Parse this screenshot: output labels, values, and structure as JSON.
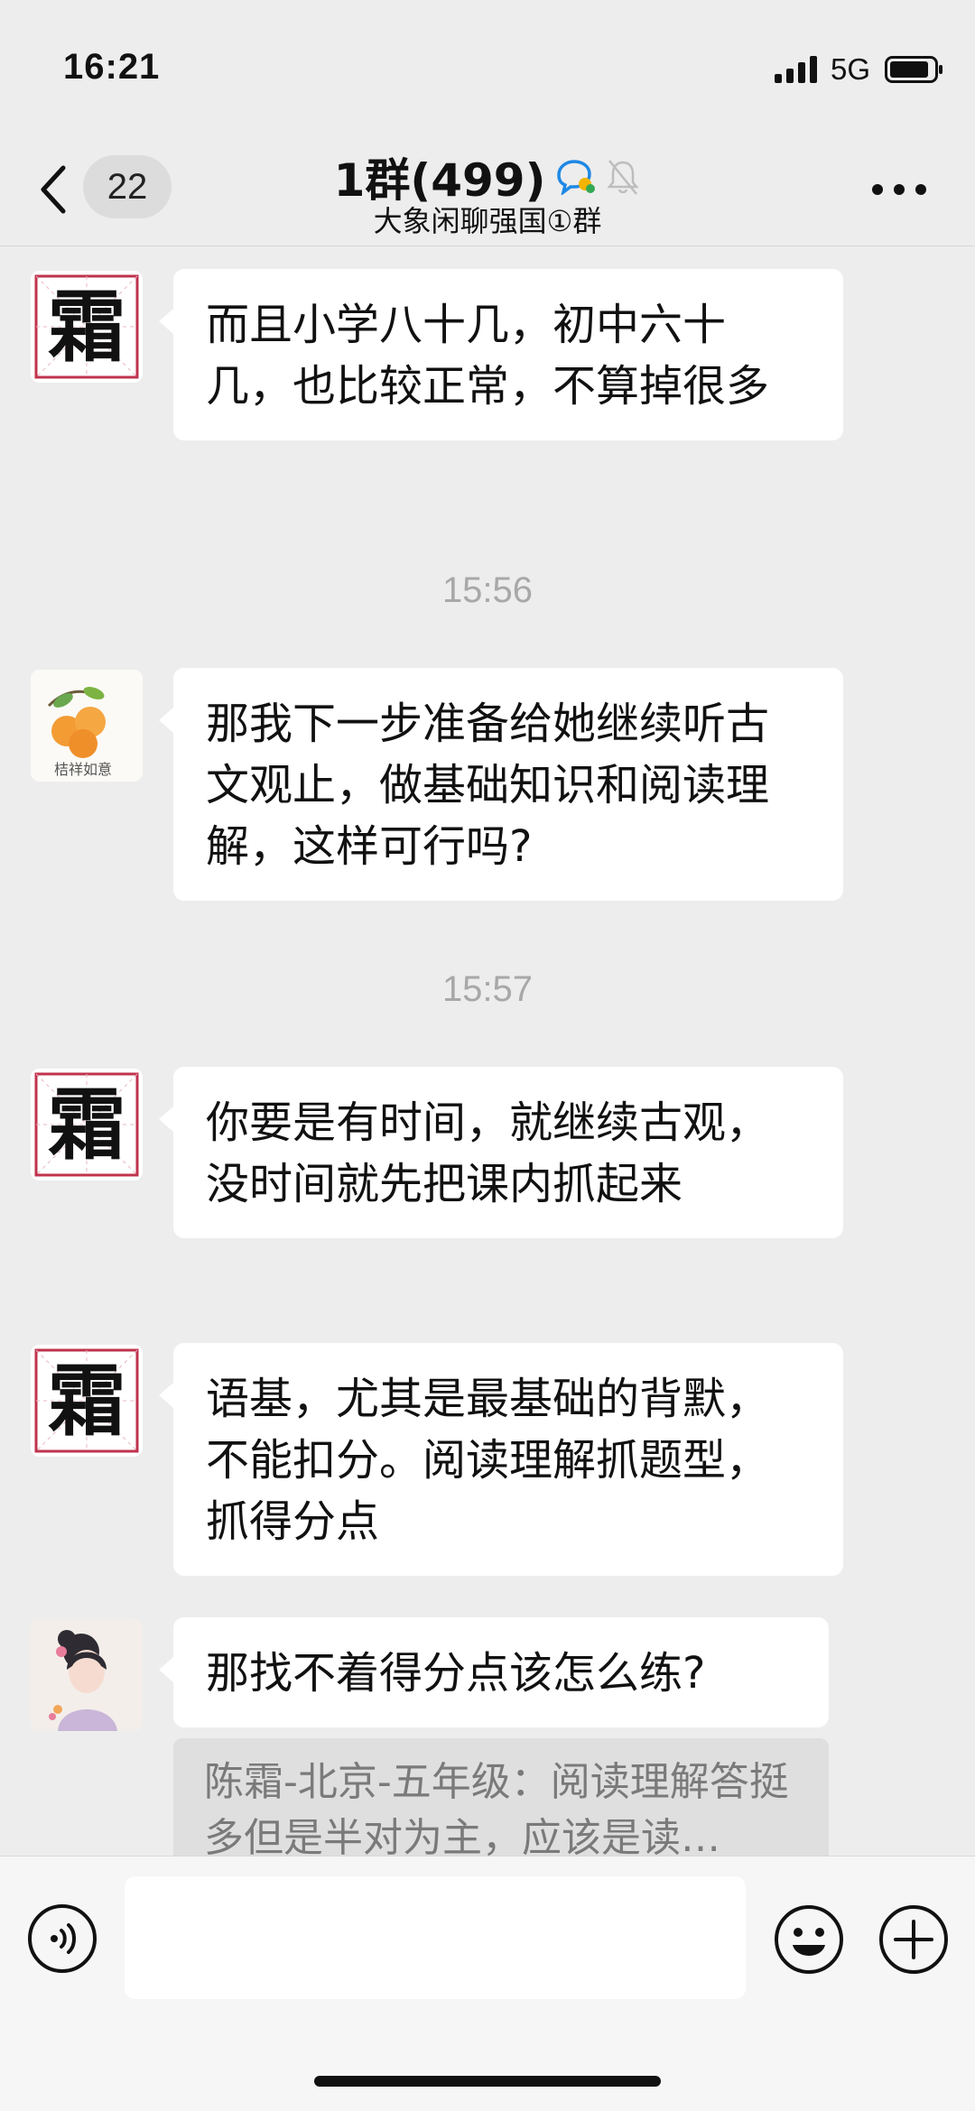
{
  "status": {
    "time": "16:21",
    "network": "5G"
  },
  "nav": {
    "unread_count": "22",
    "title": "1群(499)",
    "subtitle": "大象闲聊强国①群"
  },
  "messages": [
    {
      "sender_avatar": "霜",
      "text": "而且小学八十几，初中六十几，也比较正常，不算掉很多"
    },
    {
      "timestamp": "15:56"
    },
    {
      "sender_avatar_label": "桔祥如意",
      "text": "那我下一步准备给她继续听古文观止，做基础知识和阅读理解，这样可行吗?"
    },
    {
      "timestamp": "15:57"
    },
    {
      "sender_avatar": "霜",
      "text": "你要是有时间，就继续古观，没时间就先把课内抓起来"
    },
    {
      "sender_avatar": "霜",
      "text": "语基，尤其是最基础的背默，不能扣分。阅读理解抓题型，抓得分点"
    },
    {
      "text": "那找不着得分点该怎么练?"
    }
  ],
  "quote": {
    "text": "陈霜-北京-五年级：阅读理解答挺多但是半对为主，应该是读…"
  },
  "colors": {
    "background": "#ededed",
    "bubble": "#ffffff",
    "timestamp": "#a8a8a8",
    "avatar_char_frame": "#c0334d"
  }
}
